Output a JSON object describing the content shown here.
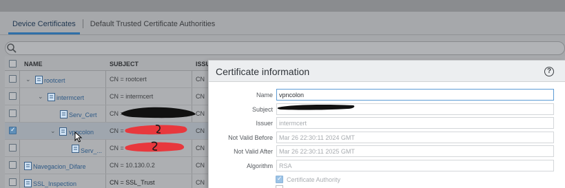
{
  "tabs": [
    "Device Certificates",
    "Default Trusted Certificate Authorities"
  ],
  "table": {
    "headers": [
      "NAME",
      "SUBJECT",
      "ISSU"
    ],
    "rows": [
      {
        "name": "rootcert",
        "subject": "CN = rootcert",
        "issuer": "CN",
        "checked": false,
        "selected": false,
        "indent": 1,
        "expander": "chevron-down"
      },
      {
        "name": "intermcert",
        "subject": "CN = intermcert",
        "issuer": "CN",
        "checked": false,
        "selected": false,
        "indent": 2,
        "expander": "chevron-down"
      },
      {
        "name": "Serv_Cert",
        "subject": "CN =",
        "issuer": "CN",
        "checked": false,
        "selected": false,
        "indent": 3,
        "expander": ""
      },
      {
        "name": "vpncolon",
        "subject": "CN =",
        "issuer": "CN",
        "checked": true,
        "selected": true,
        "indent": 2,
        "expander": "chevron-down"
      },
      {
        "name": "Serv_...",
        "subject": "CN =",
        "issuer": "CN",
        "checked": false,
        "selected": false,
        "indent": 3,
        "expander": ""
      },
      {
        "name": "Navegacion_Difare",
        "subject": "CN = 10.130.0.2",
        "issuer": "CN",
        "checked": false,
        "selected": false,
        "indent": 0,
        "expander": ""
      },
      {
        "name": "SSL_Inspection",
        "subject": "CN = SSL_Trust",
        "issuer": "CN",
        "checked": false,
        "selected": false,
        "indent": 0,
        "expander": ""
      }
    ]
  },
  "dialog": {
    "title": "Certificate information",
    "fields": [
      {
        "label": "Name",
        "value": "vpncolon"
      },
      {
        "label": "Subject",
        "value": ""
      },
      {
        "label": "Issuer",
        "value": "intermcert"
      },
      {
        "label": "Not Valid Before",
        "value": "Mar 26 22:30:11 2024 GMT"
      },
      {
        "label": "Not Valid After",
        "value": "Mar 26 22:30:11 2025 GMT"
      },
      {
        "label": "Algorithm",
        "value": "RSA"
      }
    ],
    "certificate_authority_label": "Certificate Authority",
    "certificate_authority_checked": true
  },
  "colors": {
    "accent": "#2f6fa8",
    "redaction_red": "#e8383d",
    "redaction_black": "#111111"
  }
}
